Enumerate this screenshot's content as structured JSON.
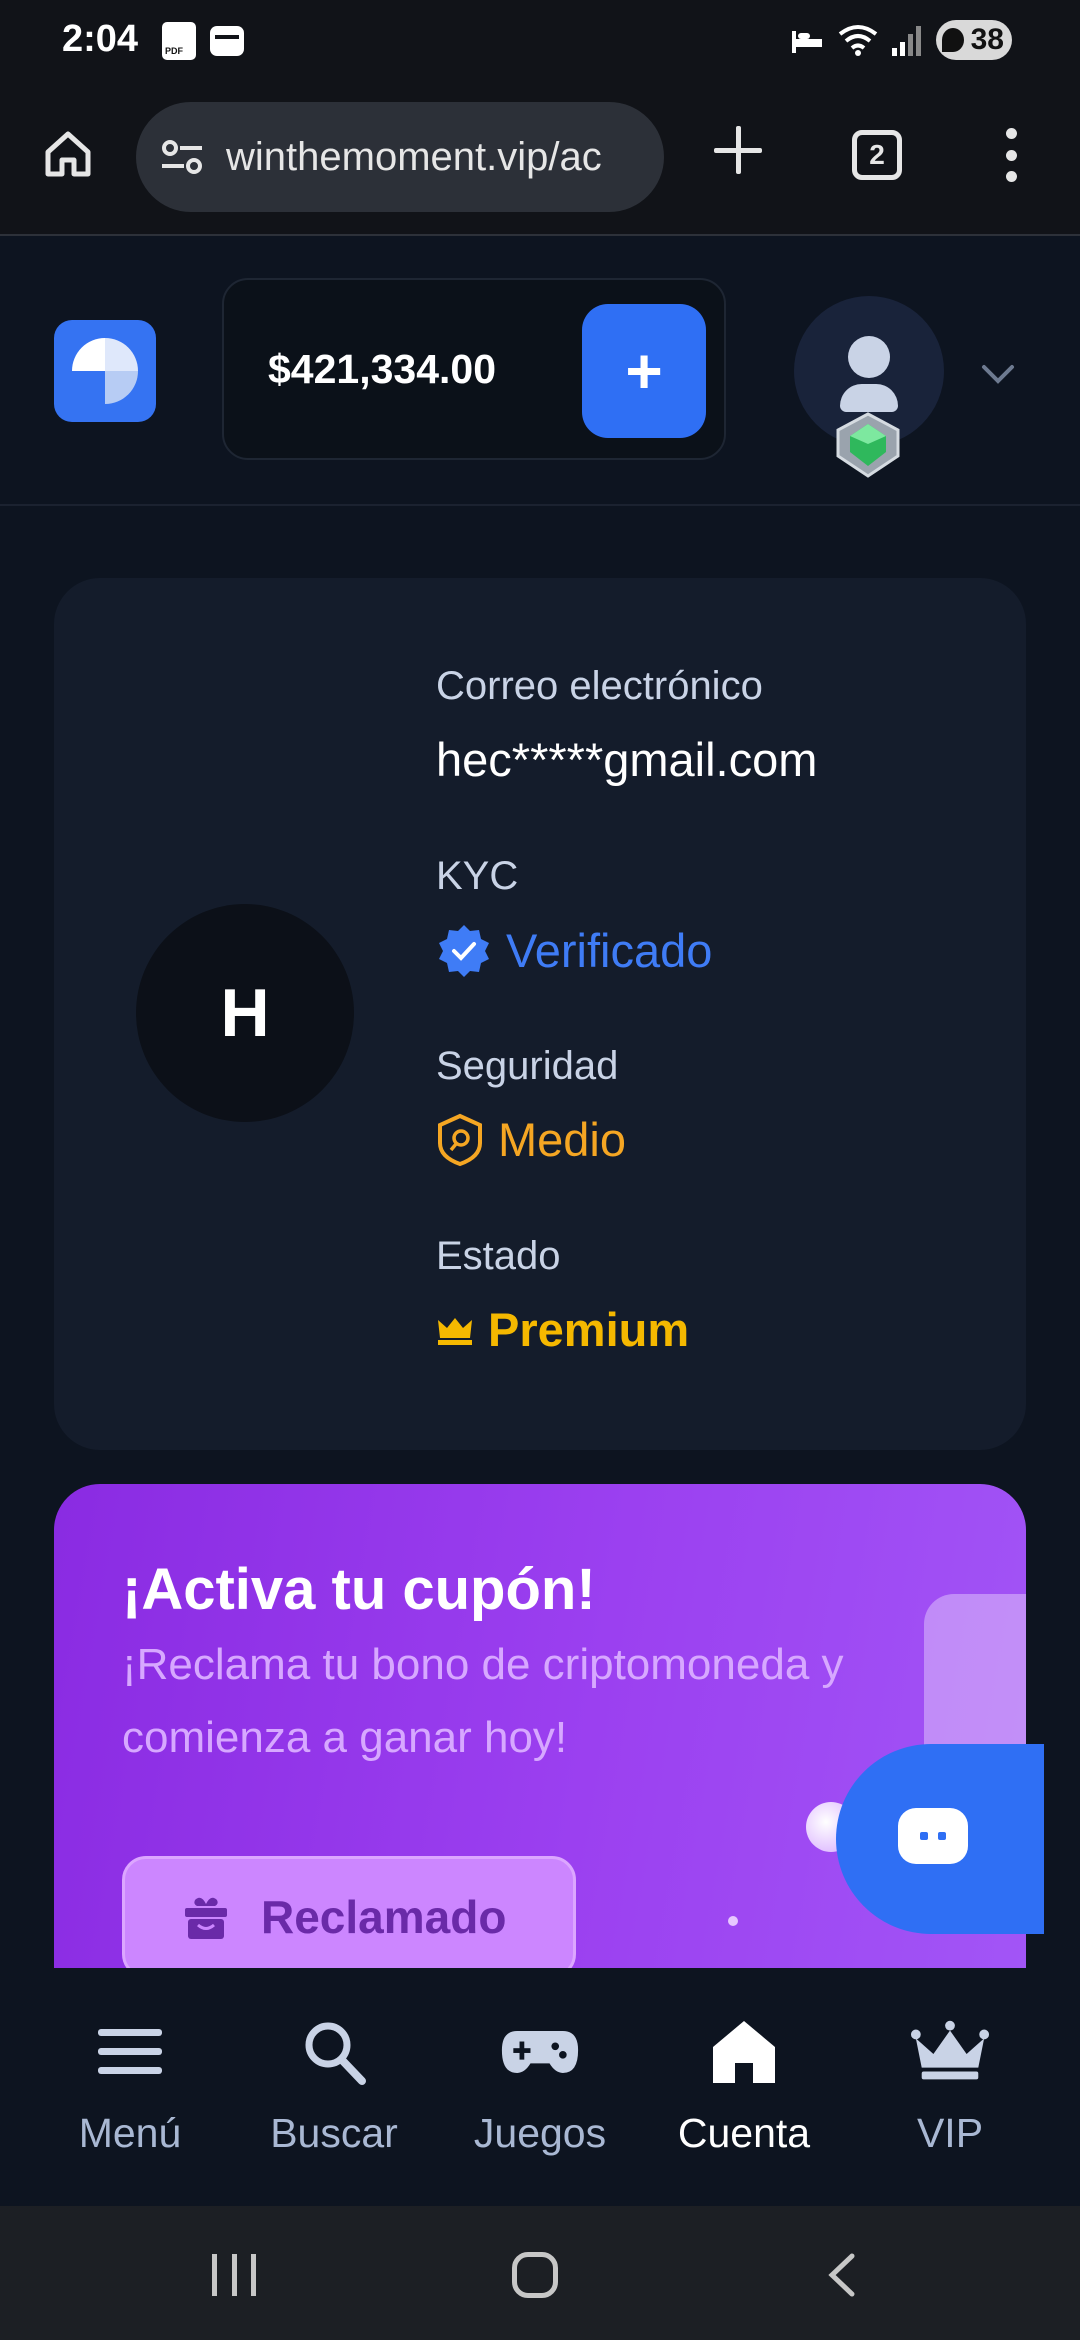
{
  "status": {
    "time": "2:04",
    "battery": "38"
  },
  "browser": {
    "url": "winthemoment.vip/ac",
    "tab_count": "2"
  },
  "header": {
    "balance": "$421,334.00",
    "deposit_symbol": "+"
  },
  "profile": {
    "avatar_initial": "H",
    "email_label": "Correo electrónico",
    "email_value": "hec*****gmail.com",
    "kyc_label": "KYC",
    "kyc_value": "Verificado",
    "security_label": "Seguridad",
    "security_value": "Medio",
    "status_label": "Estado",
    "status_value": "Premium"
  },
  "coupon": {
    "title": "¡Activa tu cupón!",
    "description": "¡Reclama tu bono de criptomoneda y comienza a ganar hoy!",
    "button_label": "Reclamado"
  },
  "nav": {
    "items": [
      {
        "label": "Menú",
        "icon": "hamburger-icon"
      },
      {
        "label": "Buscar",
        "icon": "search-icon"
      },
      {
        "label": "Juegos",
        "icon": "gamepad-icon"
      },
      {
        "label": "Cuenta",
        "icon": "home-icon",
        "active": true
      },
      {
        "label": "VIP",
        "icon": "crown-icon"
      }
    ]
  },
  "colors": {
    "accent": "#2f6ff4",
    "verified": "#3f7cf6",
    "security": "#f5a623",
    "premium": "#f5b800",
    "coupon": "#9b40f0"
  }
}
